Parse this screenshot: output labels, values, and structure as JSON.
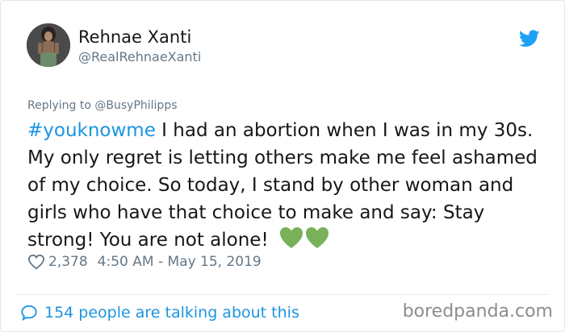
{
  "author": {
    "name": "Rehnae Xanti",
    "handle": "@RealRehnaeXanti",
    "avatar_icon": "profile-photo"
  },
  "reply": {
    "prefix": "Replying to ",
    "to": "@BusyPhilipps"
  },
  "tweet": {
    "hashtag": "#youknowme",
    "body": " I had an abortion when I was in my 30s. My only regret is letting others make me feel ashamed of my choice. So today, I stand by other woman and girls who have that choice to make and say: Stay strong! You are not alone!"
  },
  "meta": {
    "likes": "2,378",
    "timestamp": "4:50 AM - May 15, 2019"
  },
  "footer": {
    "talking": "154 people are talking about this"
  },
  "watermark": "boredpanda.com",
  "colors": {
    "link_blue": "#1b95e0",
    "twitter_blue": "#1da1f2",
    "muted": "#657786",
    "heart_green": "#78b159"
  }
}
